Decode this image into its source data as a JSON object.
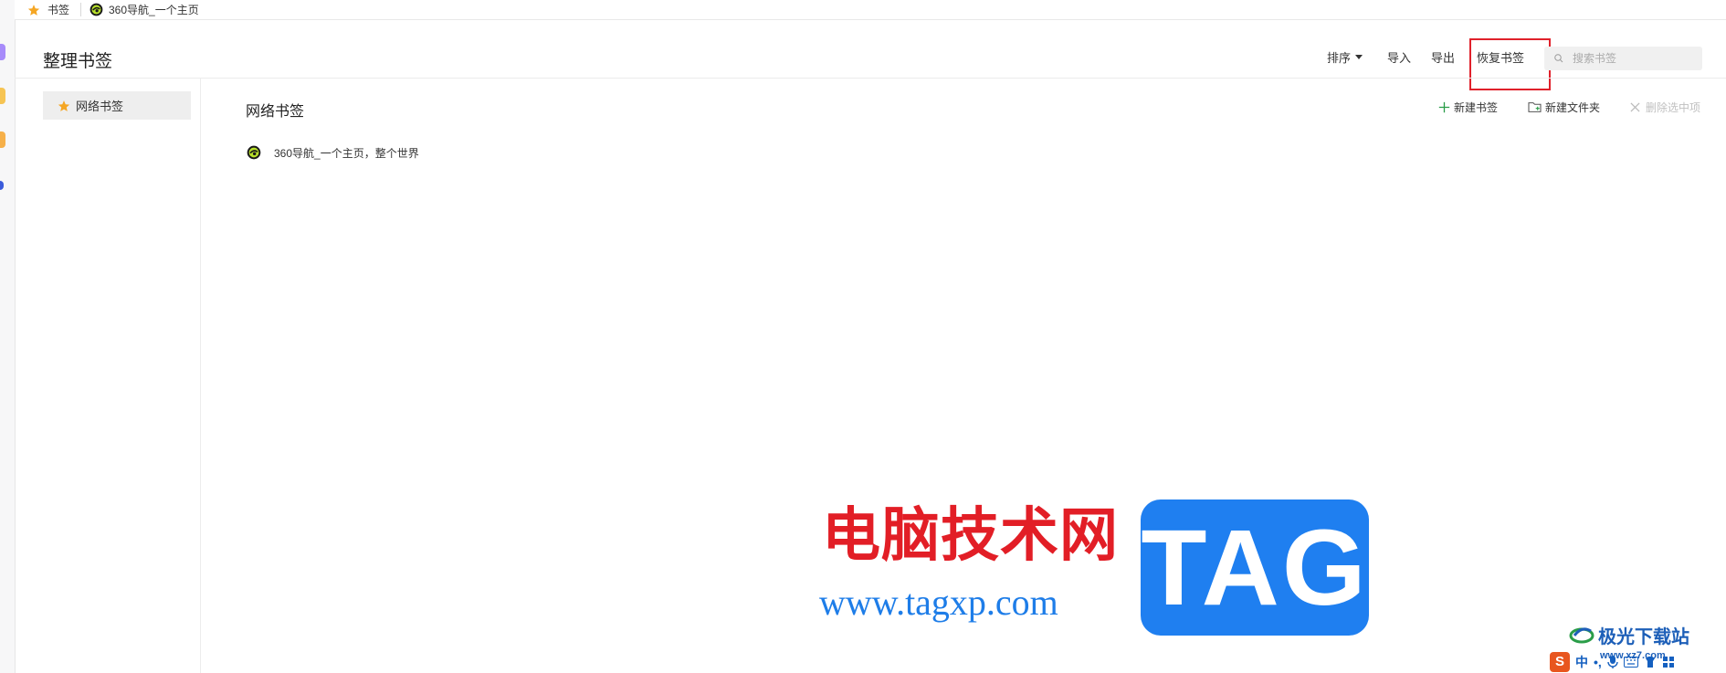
{
  "bookmark_bar": {
    "items": [
      {
        "label": "书签"
      },
      {
        "label": "360导航_一个主页"
      }
    ]
  },
  "header": {
    "title": "整理书签",
    "sort_label": "排序",
    "import_label": "导入",
    "export_label": "导出",
    "restore_label": "恢复书签",
    "search_placeholder": "搜索书签"
  },
  "sidebar": {
    "items": [
      {
        "label": "网络书签",
        "icon": "star-icon",
        "selected": true
      }
    ]
  },
  "main": {
    "section_title": "网络书签",
    "actions": {
      "new_bookmark": "新建书签",
      "new_folder": "新建文件夹",
      "delete_selected": "删除选中项"
    },
    "bookmarks": [
      {
        "title": "360导航_一个主页，整个世界",
        "icon": "360-logo-icon"
      }
    ]
  },
  "watermark": {
    "cn_text": "电脑技术网",
    "url": "www.tagxp.com",
    "tag_text": "TAG",
    "corner_brand": "极光下载站",
    "corner_sub": "www.xz7.com"
  },
  "ime_bar": {
    "mode": "中"
  },
  "colors": {
    "highlight_border": "#e0212b",
    "star": "#f5a623",
    "watermark_red": "#e21e26",
    "watermark_blue": "#1f7ff0"
  }
}
